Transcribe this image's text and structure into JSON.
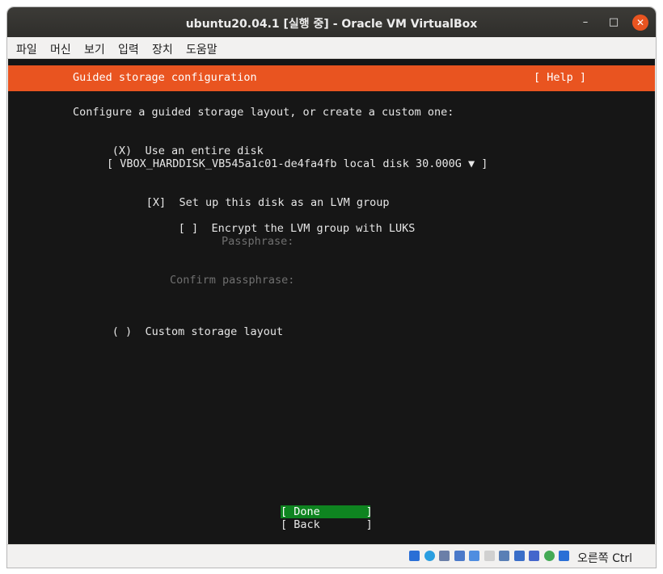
{
  "window": {
    "title": "ubuntu20.04.1 [실행 중] - Oracle VM VirtualBox",
    "controls": {
      "minimize": "–",
      "maximize": "□",
      "close": "✕"
    }
  },
  "menubar": {
    "items": [
      "파일",
      "머신",
      "보기",
      "입력",
      "장치",
      "도움말"
    ]
  },
  "installer": {
    "header_title": "Guided storage configuration",
    "help_label": "[ Help ]",
    "intro": "Configure a guided storage layout, or create a custom one:",
    "entire_disk": {
      "marker": "(X)",
      "label": "Use an entire disk"
    },
    "disk_select": "[ VBOX_HARDDISK_VB545a1c01-de4fa4fb local disk 30.000G ▼ ]",
    "lvm": {
      "marker": "[X]",
      "label": "Set up this disk as an LVM group"
    },
    "encrypt": {
      "marker": "[ ]",
      "label": "Encrypt the LVM group with LUKS"
    },
    "passphrase_label": "Passphrase:",
    "confirm_label": "Confirm passphrase:",
    "custom": {
      "marker": "( )",
      "label": "Custom storage layout"
    },
    "done_button": "[ Done       ]",
    "back_button": "[ Back       ]"
  },
  "statusbar": {
    "host_key": "오른쪽 Ctrl",
    "icon_colors": [
      "#2a6fd6",
      "#2a9ee0",
      "#6b7fa8",
      "#4a79c9",
      "#4f8de0",
      "#d0d0d0",
      "#5a7fb5",
      "#3a6ec8",
      "#4466cc",
      "#44aa55",
      "#2a6fd6"
    ]
  },
  "colors": {
    "accent": "#e95420",
    "done_bg": "#0e8420",
    "terminal_bg": "#161616"
  }
}
